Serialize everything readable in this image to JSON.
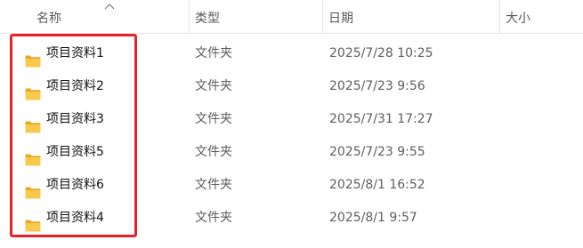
{
  "columns": {
    "name": "名称",
    "type": "类型",
    "date": "日期",
    "size": "大小"
  },
  "files": [
    {
      "name": "项目资料1",
      "type": "文件夹",
      "date": "2025/7/28 10:25",
      "size": ""
    },
    {
      "name": "项目资料2",
      "type": "文件夹",
      "date": "2025/7/23 9:56",
      "size": ""
    },
    {
      "name": "项目资料3",
      "type": "文件夹",
      "date": "2025/7/31 17:27",
      "size": ""
    },
    {
      "name": "项目资料5",
      "type": "文件夹",
      "date": "2025/7/23 9:55",
      "size": ""
    },
    {
      "name": "项目资料6",
      "type": "文件夹",
      "date": "2025/8/1 16:52",
      "size": ""
    },
    {
      "name": "项目资料4",
      "type": "文件夹",
      "date": "2025/8/1 9:57",
      "size": ""
    }
  ],
  "icons": {
    "folder": "folder-icon",
    "sort": "sort-up-arrow-icon"
  },
  "colors": {
    "highlight": "#e5222a",
    "folder_front": "#f9c94c",
    "folder_back": "#e8a825"
  }
}
